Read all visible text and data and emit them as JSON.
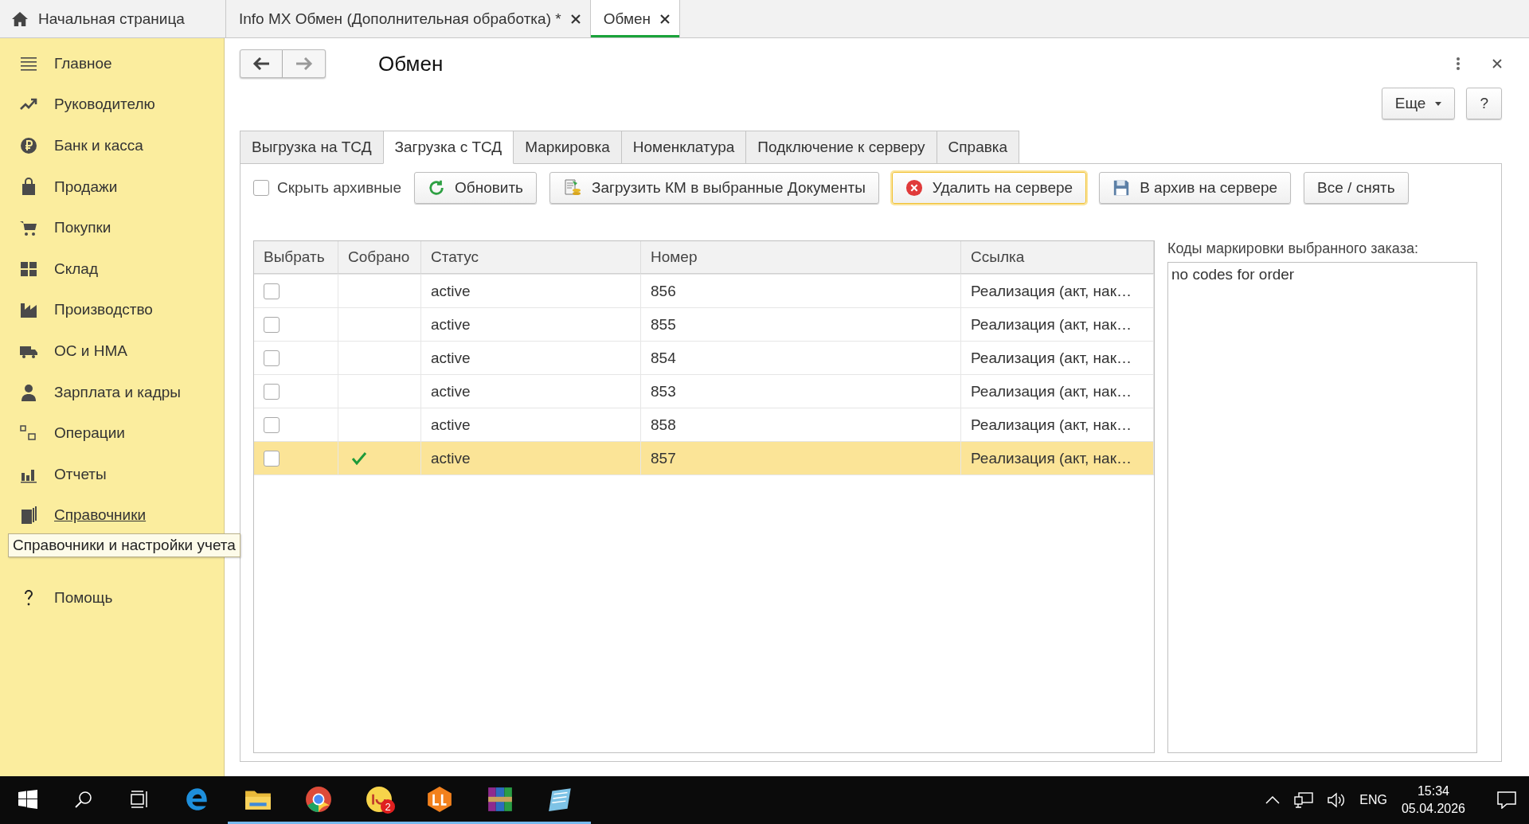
{
  "top_tabs": [
    {
      "kind": "home",
      "label": "Начальная страница",
      "selected": false
    },
    {
      "kind": "doc",
      "label": "Info MX Обмен (Дополнительная обработка) *",
      "selected": false
    },
    {
      "kind": "doc",
      "label": "Обмен",
      "selected": true
    }
  ],
  "sidebar": {
    "items": [
      {
        "label": "Главное",
        "hovered": false
      },
      {
        "label": "Руководителю",
        "hovered": false
      },
      {
        "label": "Банк и касса",
        "hovered": false
      },
      {
        "label": "Продажи",
        "hovered": false
      },
      {
        "label": "Покупки",
        "hovered": false
      },
      {
        "label": "Склад",
        "hovered": false
      },
      {
        "label": "Производство",
        "hovered": false
      },
      {
        "label": "ОС и НМА",
        "hovered": false
      },
      {
        "label": "Зарплата и кадры",
        "hovered": false
      },
      {
        "label": "Операции",
        "hovered": false
      },
      {
        "label": "Отчеты",
        "hovered": false
      },
      {
        "label": "Справочники",
        "hovered": true
      },
      {
        "label": "Помощь",
        "hovered": false
      }
    ],
    "tooltip": "Справочники и настройки учета"
  },
  "form": {
    "title": "Обмен",
    "more_button": "Еще",
    "help_button": "?",
    "tabs": [
      {
        "label": "Выгрузка на ТСД",
        "selected": false
      },
      {
        "label": "Загрузка с ТСД",
        "selected": true
      },
      {
        "label": "Маркировка",
        "selected": false
      },
      {
        "label": "Номенклатура",
        "selected": false
      },
      {
        "label": "Подключение к серверу",
        "selected": false
      },
      {
        "label": "Справка",
        "selected": false
      }
    ],
    "hide_archived": {
      "label": "Скрыть архивные",
      "checked": false
    },
    "buttons": [
      {
        "label": "Обновить",
        "focused": false
      },
      {
        "label": "Загрузить КМ в выбранные Документы",
        "focused": false
      },
      {
        "label": "Удалить на сервере",
        "focused": true
      },
      {
        "label": "В архив на сервере",
        "focused": false
      },
      {
        "label": "Все / снять",
        "focused": false
      }
    ],
    "table": {
      "columns": [
        "Выбрать",
        "Собрано",
        "Статус",
        "Номер",
        "Ссылка"
      ],
      "rows": [
        {
          "checked": false,
          "collected": false,
          "status": "active",
          "number": "856",
          "link": "Реализация (акт, нак…",
          "selected": false
        },
        {
          "checked": false,
          "collected": false,
          "status": "active",
          "number": "855",
          "link": "Реализация (акт, нак…",
          "selected": false
        },
        {
          "checked": false,
          "collected": false,
          "status": "active",
          "number": "854",
          "link": "Реализация (акт, нак…",
          "selected": false
        },
        {
          "checked": false,
          "collected": false,
          "status": "active",
          "number": "853",
          "link": "Реализация (акт, нак…",
          "selected": false
        },
        {
          "checked": false,
          "collected": false,
          "status": "active",
          "number": "858",
          "link": "Реализация (акт, нак…",
          "selected": false
        },
        {
          "checked": false,
          "collected": true,
          "status": "active",
          "number": "857",
          "link": "Реализация (акт, нак…",
          "selected": true
        }
      ]
    },
    "codes": {
      "label": "Коды маркировки выбранного заказа:",
      "value": "no codes for order"
    }
  },
  "taskbar": {
    "apps": [
      {
        "active": false
      },
      {
        "active": true
      },
      {
        "active": true
      },
      {
        "active": true,
        "badge": "2"
      },
      {
        "active": true
      },
      {
        "active": true
      },
      {
        "active": true
      }
    ],
    "language": "ENG",
    "time": "15:34",
    "date": "05.04.2026"
  }
}
